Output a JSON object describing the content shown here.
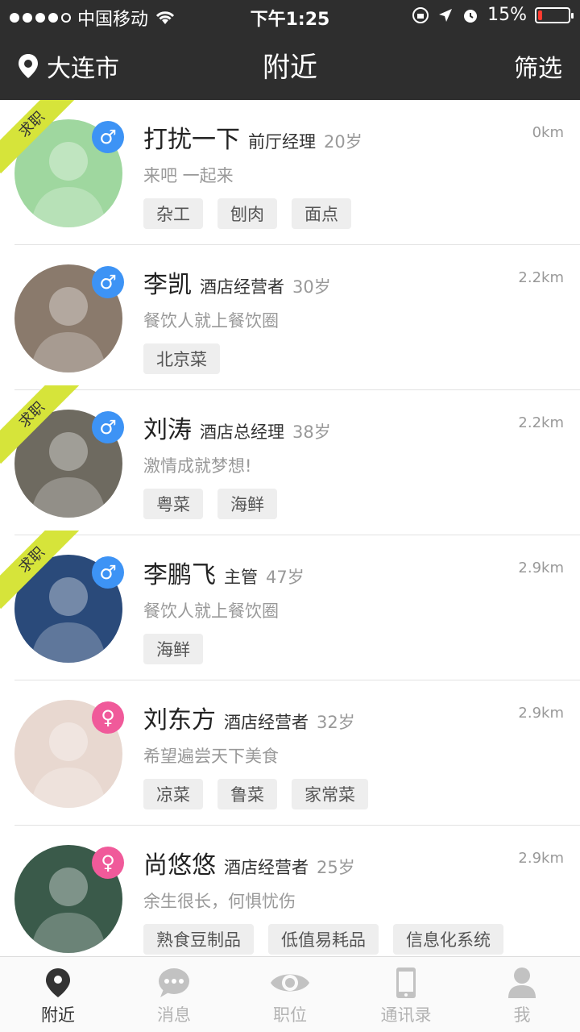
{
  "status_bar": {
    "carrier": "中国移动",
    "time": "下午1:25",
    "battery": "15%",
    "battery_level": 0.15
  },
  "header": {
    "city": "大连市",
    "title": "附近",
    "filter": "筛选"
  },
  "items": [
    {
      "name": "打扰一下",
      "role": "前厅经理",
      "age": "20岁",
      "distance": "0km",
      "motto": "来吧 一起来",
      "tags": [
        "杂工",
        "刨肉",
        "面点"
      ],
      "gender": "♂",
      "badge": "求职",
      "avatar_color": "#9fd79f"
    },
    {
      "name": "李凯",
      "role": "酒店经营者",
      "age": "30岁",
      "distance": "2.2km",
      "motto": "餐饮人就上餐饮圈",
      "tags": [
        "北京菜"
      ],
      "gender": "♂",
      "badge": "",
      "avatar_color": "#8a7a6c"
    },
    {
      "name": "刘涛",
      "role": "酒店总经理",
      "age": "38岁",
      "distance": "2.2km",
      "motto": "激情成就梦想!",
      "tags": [
        "粤菜",
        "海鲜"
      ],
      "gender": "♂",
      "badge": "求职",
      "avatar_color": "#6e6a60"
    },
    {
      "name": "李鹏飞",
      "role": "主管",
      "age": "47岁",
      "distance": "2.9km",
      "motto": "餐饮人就上餐饮圈",
      "tags": [
        "海鲜"
      ],
      "gender": "♂",
      "badge": "求职",
      "avatar_color": "#2a4a7a"
    },
    {
      "name": "刘东方",
      "role": "酒店经营者",
      "age": "32岁",
      "distance": "2.9km",
      "motto": "希望遍尝天下美食",
      "tags": [
        "凉菜",
        "鲁菜",
        "家常菜"
      ],
      "gender": "♀",
      "badge": "",
      "avatar_color": "#e8d8d0"
    },
    {
      "name": "尚悠悠",
      "role": "酒店经营者",
      "age": "25岁",
      "distance": "2.9km",
      "motto": "余生很长，何惧忧伤",
      "tags": [
        "熟食豆制品",
        "低值易耗品",
        "信息化系统"
      ],
      "gender": "♀",
      "badge": "",
      "avatar_color": "#3a5a4a"
    }
  ],
  "tabbar": [
    {
      "label": "附近",
      "icon": "location-pin-icon",
      "active": true
    },
    {
      "label": "消息",
      "icon": "chat-bubble-icon",
      "active": false
    },
    {
      "label": "职位",
      "icon": "eye-icon",
      "active": false
    },
    {
      "label": "通讯录",
      "icon": "phone-icon",
      "active": false
    },
    {
      "label": "我",
      "icon": "person-icon",
      "active": false
    }
  ],
  "colors": {
    "header_bg": "#2e2e2e",
    "badge": "#d6e43a",
    "male": "#3d93f5",
    "female": "#f05a9a"
  }
}
